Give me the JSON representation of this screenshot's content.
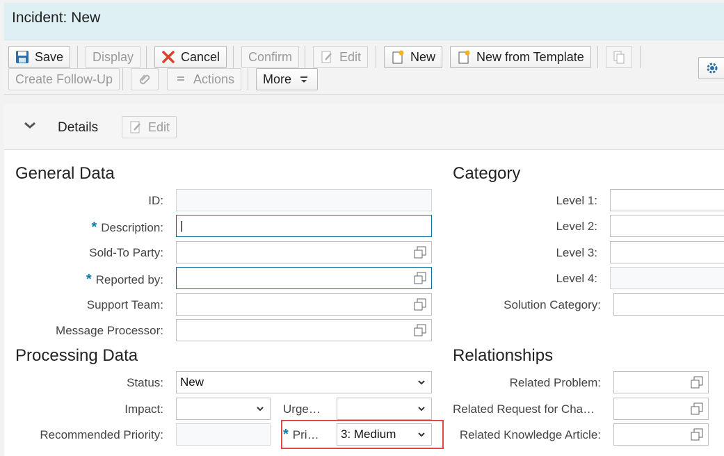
{
  "window": {
    "title": "Incident: New"
  },
  "toolbar": {
    "save": "Save",
    "display": "Display",
    "cancel": "Cancel",
    "confirm": "Confirm",
    "edit": "Edit",
    "new": "New",
    "new_from_template": "New from Template",
    "create_follow_up": "Create Follow-Up",
    "actions": "Actions",
    "more": "More"
  },
  "details": {
    "label": "Details",
    "edit": "Edit"
  },
  "general_data": {
    "title": "General Data",
    "fields": {
      "id": {
        "label": "ID:",
        "value": ""
      },
      "description": {
        "label": "Description:",
        "required": "*",
        "value": "|"
      },
      "sold_to": {
        "label": "Sold-To Party:",
        "value": ""
      },
      "reported_by": {
        "label": "Reported by:",
        "required": "*",
        "value": ""
      },
      "support_team": {
        "label": "Support Team:",
        "value": ""
      },
      "message_processor": {
        "label": "Message Processor:",
        "value": ""
      }
    }
  },
  "category": {
    "title": "Category",
    "level1": "Level 1:",
    "level2": "Level 2:",
    "level3": "Level 3:",
    "level4": "Level 4:",
    "solution_category": "Solution Category:"
  },
  "processing_data": {
    "title": "Processing Data",
    "status": {
      "label": "Status:",
      "value": "New"
    },
    "impact": {
      "label": "Impact:",
      "value": ""
    },
    "urgency": {
      "label": "Urge…",
      "value": ""
    },
    "recommended_priority": {
      "label": "Recommended Priority:",
      "value": ""
    },
    "priority": {
      "label": "Pri…",
      "required": "*",
      "value": "3: Medium"
    }
  },
  "relationships": {
    "title": "Relationships",
    "related_problem": "Related Problem:",
    "related_request": "Related Request for Cha…",
    "related_knowledge": "Related Knowledge Article:"
  },
  "colors": {
    "accent": "#0a7fb0",
    "highlight": "#e04848",
    "title_bg": "#dff0f5"
  }
}
